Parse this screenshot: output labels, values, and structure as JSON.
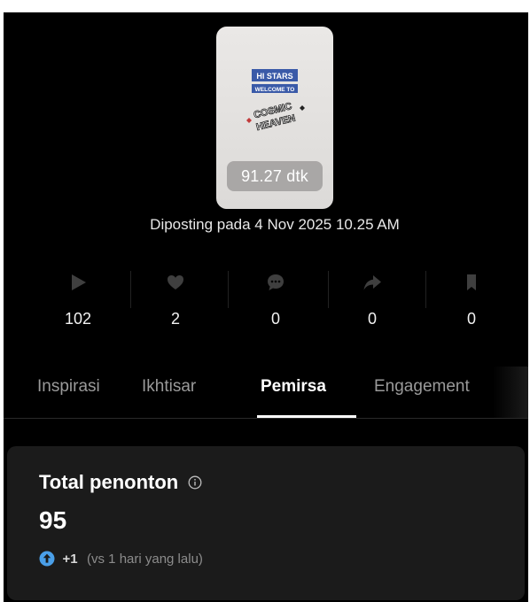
{
  "video": {
    "thumbnail_logo_line1": "HI STARS",
    "thumbnail_logo_line2": "WELCOME TO",
    "thumbnail_logo_line3": "COSMIC",
    "thumbnail_logo_line4": "HEAVEN",
    "duration": "91.27 dtk",
    "posted_text": "Diposting pada 4 Nov 2025 10.25 AM"
  },
  "stats": [
    {
      "icon": "play-icon",
      "value": "102"
    },
    {
      "icon": "heart-icon",
      "value": "2"
    },
    {
      "icon": "comment-icon",
      "value": "0"
    },
    {
      "icon": "share-icon",
      "value": "0"
    },
    {
      "icon": "bookmark-icon",
      "value": "0"
    }
  ],
  "tabs": [
    {
      "label": "Inspirasi",
      "active": false
    },
    {
      "label": "Ikhtisar",
      "active": false
    },
    {
      "label": "Pemirsa",
      "active": true
    },
    {
      "label": "Engagement",
      "active": false
    }
  ],
  "card": {
    "title": "Total penonton",
    "info_icon": "info-icon",
    "total": "95",
    "delta_icon": "arrow-up-circle-icon",
    "delta": "+1",
    "delta_compare": "(vs 1 hari yang lalu)"
  },
  "colors": {
    "background": "#000000",
    "card_background": "#1b1b1b",
    "accent_blue": "#4a9fe8",
    "icon_gray": "#3f3f3f"
  }
}
